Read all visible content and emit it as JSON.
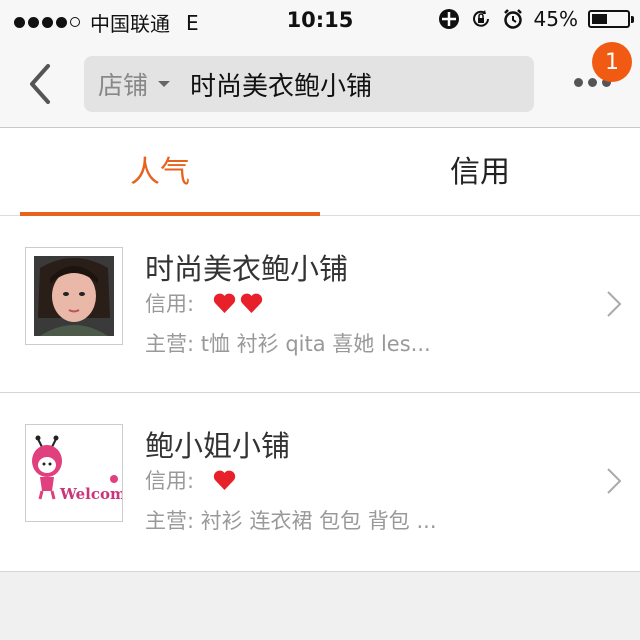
{
  "status": {
    "carrier": "中国联通",
    "network": "E",
    "time": "10:15",
    "battery": "45%",
    "battery_level": 0.45
  },
  "nav": {
    "search_scope": "店铺",
    "search_query": "时尚美衣鲍小铺",
    "notification_count": "1"
  },
  "tabs": [
    {
      "label": "人气",
      "active": true
    },
    {
      "label": "信用",
      "active": false
    }
  ],
  "shops": [
    {
      "name": "时尚美衣鲍小铺",
      "credit_label": "信用:",
      "credit_hearts": 2,
      "main_label": "主营:",
      "main_items": "t恤 衬衫 qita 喜她 les..."
    },
    {
      "name": "鲍小姐小铺",
      "credit_label": "信用:",
      "credit_hearts": 1,
      "main_label": "主营:",
      "main_items": "衬衫 连衣裙 包包 背包 ...",
      "logo_text": "Welcome"
    }
  ],
  "colors": {
    "accent": "#e8621e",
    "badge": "#f05a12",
    "heart": "#e8202a"
  }
}
